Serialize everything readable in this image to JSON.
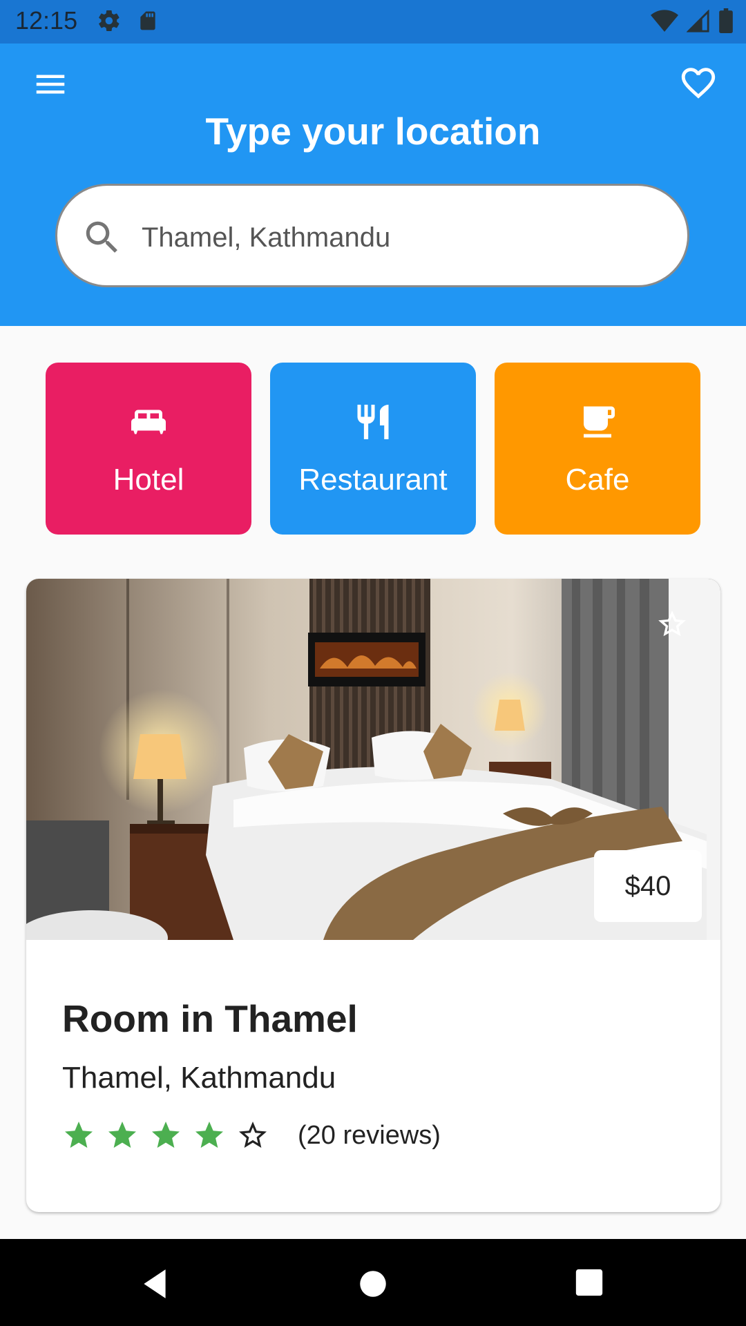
{
  "status_bar": {
    "time": "12:15",
    "icons": [
      "settings-icon",
      "sd-card-icon",
      "wifi-icon",
      "signal-icon",
      "battery-icon"
    ]
  },
  "app_bar": {
    "title": "Type your location",
    "menu_icon": "menu-icon",
    "favorite_icon": "heart-outline-icon",
    "search": {
      "value": "Thamel, Kathmandu",
      "placeholder": "",
      "icon": "search-icon"
    }
  },
  "categories": [
    {
      "label": "Hotel",
      "icon": "bed-icon",
      "color": "#e91e63"
    },
    {
      "label": "Restaurant",
      "icon": "restaurant-icon",
      "color": "#2196f3"
    },
    {
      "label": "Cafe",
      "icon": "cafe-icon",
      "color": "#ff9800"
    }
  ],
  "listing": {
    "title": "Room in Thamel",
    "location": "Thamel, Kathmandu",
    "price": "$40",
    "rating": 4,
    "rating_max": 5,
    "reviews": "(20 reviews)",
    "star_color": "#4caf50"
  },
  "colors": {
    "primary": "#2196f3",
    "status_bar": "#1976d2"
  },
  "nav_bar": {
    "icons": [
      "back-icon",
      "home-icon",
      "recent-apps-icon"
    ]
  }
}
